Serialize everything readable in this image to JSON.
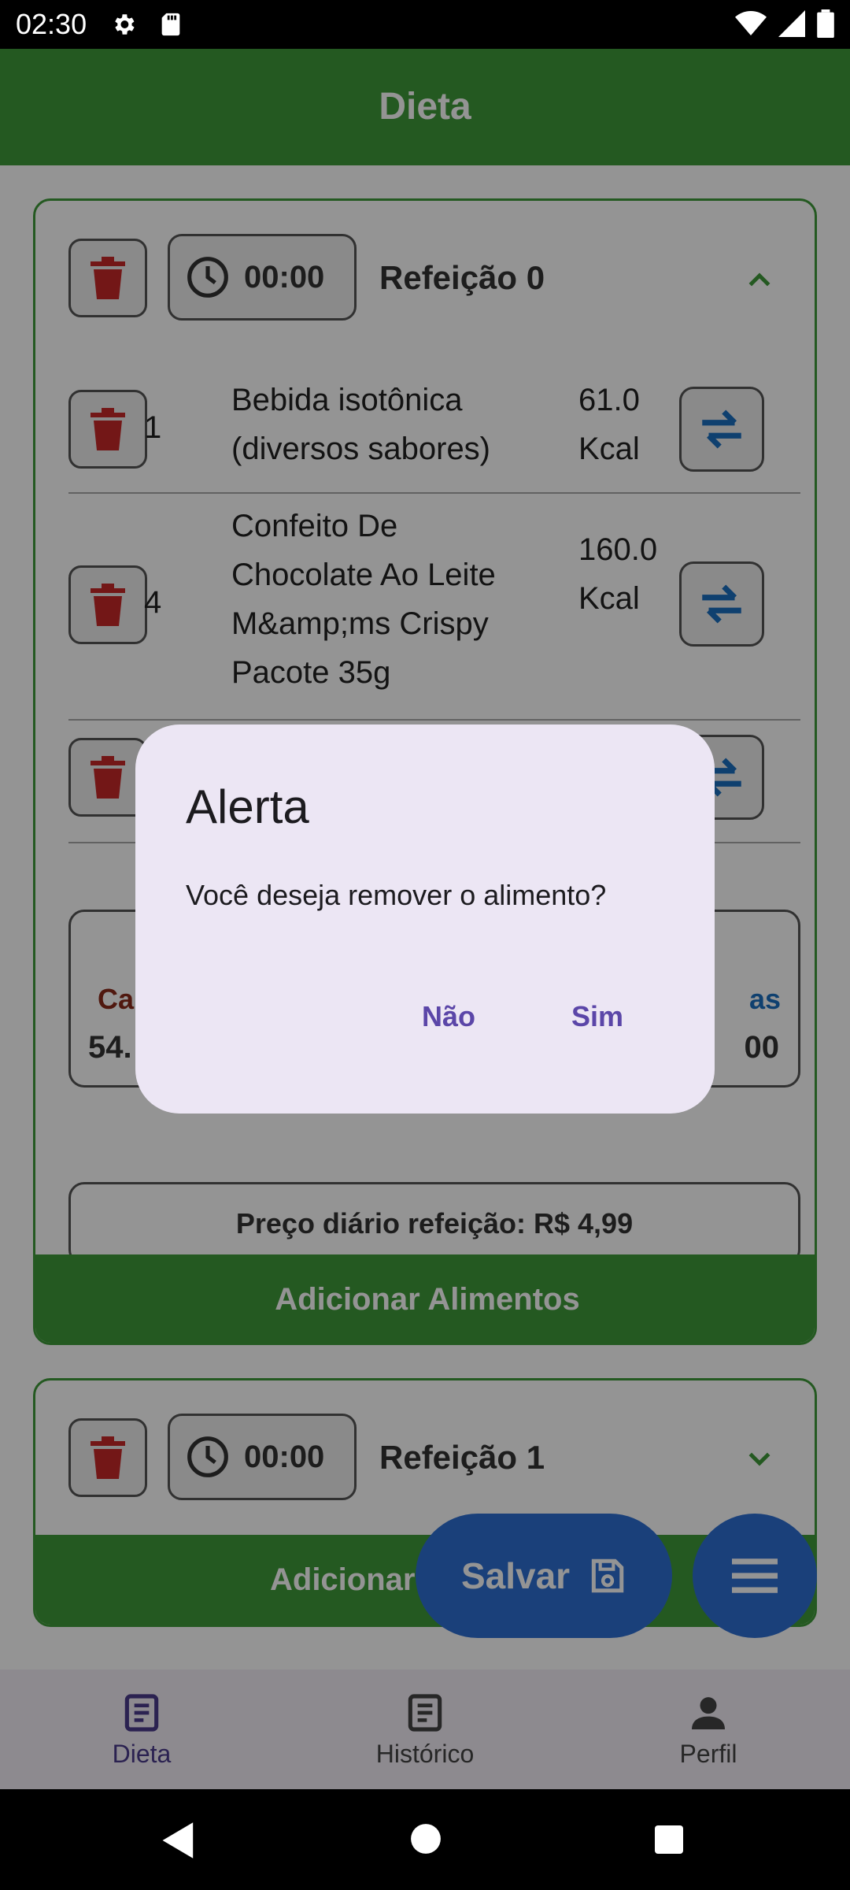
{
  "status_bar": {
    "time": "02:30",
    "icons": [
      "gear-icon",
      "sd-card-icon",
      "wifi-icon",
      "signal-icon",
      "battery-icon"
    ]
  },
  "header": {
    "title": "Dieta"
  },
  "meals": [
    {
      "time": "00:00",
      "title": "Refeição 0",
      "expanded": true,
      "foods": [
        {
          "qty": "1",
          "name": "Bebida isotônica (diversos sabores)",
          "kcal": "61.0 Kcal"
        },
        {
          "qty": "4",
          "name": "Confeito De Chocolate Ao Leite M&amp;ms Crispy Pacote 35g",
          "kcal": "160.0 Kcal"
        }
      ],
      "macros": {
        "left_label": "Ca",
        "left_value": "54.",
        "right_label": "as",
        "right_value": "00"
      },
      "price_label": "Preço diário refeição: R$ 4,99",
      "add_label": "Adicionar Alimentos"
    },
    {
      "time": "00:00",
      "title": "Refeição 1",
      "expanded": false,
      "add_label": "Adicionar"
    }
  ],
  "fab": {
    "save_label": "Salvar"
  },
  "bottom_nav": [
    {
      "label": "Dieta",
      "icon": "document-icon",
      "active": true
    },
    {
      "label": "Histórico",
      "icon": "document-icon",
      "active": false
    },
    {
      "label": "Perfil",
      "icon": "person-icon",
      "active": false
    }
  ],
  "dialog": {
    "title": "Alerta",
    "message": "Você deseja remover o alimento?",
    "cancel_label": "Não",
    "confirm_label": "Sim"
  },
  "colors": {
    "primary_green": "#3f9a3a",
    "fab_blue": "#2e6fd3",
    "delete_red": "#c62828",
    "dialog_bg": "#ece6f4",
    "dialog_accent": "#5b46a8"
  }
}
